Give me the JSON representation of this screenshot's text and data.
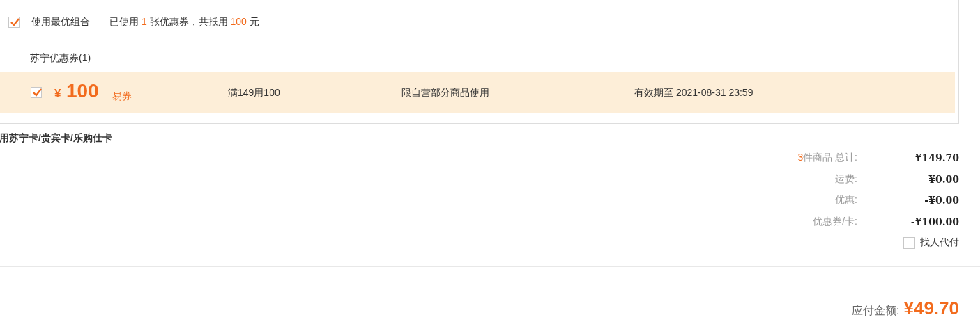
{
  "best_combo": {
    "checked": true,
    "label": "使用最优组合",
    "summary_parts": [
      {
        "text": "已使用 ",
        "highlight": false
      },
      {
        "text": "1",
        "highlight": true
      },
      {
        "text": " 张优惠券，共抵用 ",
        "highlight": false
      },
      {
        "text": "100",
        "highlight": true
      },
      {
        "text": " 元",
        "highlight": false
      }
    ]
  },
  "coupon_group": {
    "title": "苏宁优惠券(1)",
    "coupons": [
      {
        "checked": true,
        "currency": "¥",
        "amount": "100",
        "type": "易券",
        "rule": "满149用100",
        "scope": "限自营部分商品使用",
        "validity": "有效期至 2021-08-31 23:59"
      }
    ]
  },
  "cards_section": {
    "title": "用苏宁卡/贵宾卡/乐购仕卡"
  },
  "summary": {
    "rows": [
      {
        "count": "3",
        "label": "件商品 总计:",
        "value": "¥149.70"
      },
      {
        "label": "运费:",
        "value": "¥0.00"
      },
      {
        "label": "优惠:",
        "value": "-¥0.00"
      },
      {
        "label": "优惠券/卡:",
        "value": "-¥100.00"
      }
    ],
    "pay_for_me": {
      "checked": false,
      "label": "找人代付"
    }
  },
  "total": {
    "label": "应付金额:",
    "value": "¥49.70"
  }
}
